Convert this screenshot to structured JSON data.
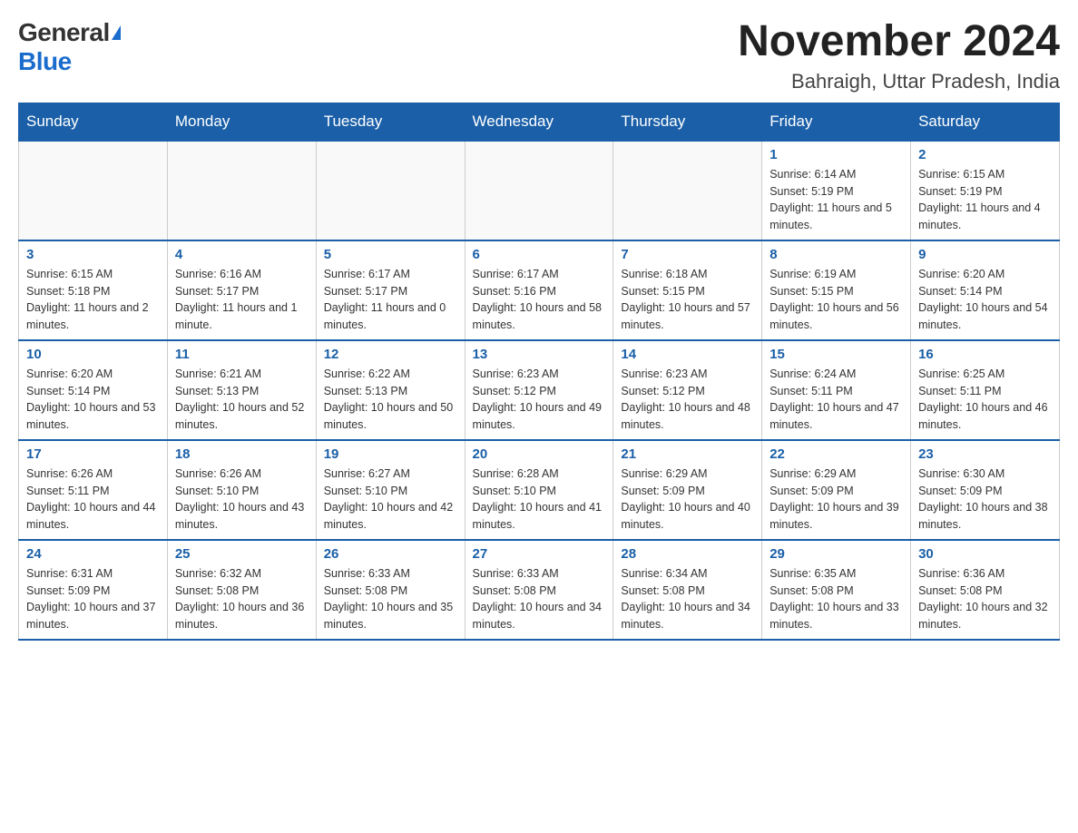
{
  "logo": {
    "general": "General",
    "blue": "Blue"
  },
  "title": {
    "month_year": "November 2024",
    "location": "Bahraigh, Uttar Pradesh, India"
  },
  "days_of_week": [
    "Sunday",
    "Monday",
    "Tuesday",
    "Wednesday",
    "Thursday",
    "Friday",
    "Saturday"
  ],
  "weeks": [
    [
      {
        "day": "",
        "info": ""
      },
      {
        "day": "",
        "info": ""
      },
      {
        "day": "",
        "info": ""
      },
      {
        "day": "",
        "info": ""
      },
      {
        "day": "",
        "info": ""
      },
      {
        "day": "1",
        "info": "Sunrise: 6:14 AM\nSunset: 5:19 PM\nDaylight: 11 hours and 5 minutes."
      },
      {
        "day": "2",
        "info": "Sunrise: 6:15 AM\nSunset: 5:19 PM\nDaylight: 11 hours and 4 minutes."
      }
    ],
    [
      {
        "day": "3",
        "info": "Sunrise: 6:15 AM\nSunset: 5:18 PM\nDaylight: 11 hours and 2 minutes."
      },
      {
        "day": "4",
        "info": "Sunrise: 6:16 AM\nSunset: 5:17 PM\nDaylight: 11 hours and 1 minute."
      },
      {
        "day": "5",
        "info": "Sunrise: 6:17 AM\nSunset: 5:17 PM\nDaylight: 11 hours and 0 minutes."
      },
      {
        "day": "6",
        "info": "Sunrise: 6:17 AM\nSunset: 5:16 PM\nDaylight: 10 hours and 58 minutes."
      },
      {
        "day": "7",
        "info": "Sunrise: 6:18 AM\nSunset: 5:15 PM\nDaylight: 10 hours and 57 minutes."
      },
      {
        "day": "8",
        "info": "Sunrise: 6:19 AM\nSunset: 5:15 PM\nDaylight: 10 hours and 56 minutes."
      },
      {
        "day": "9",
        "info": "Sunrise: 6:20 AM\nSunset: 5:14 PM\nDaylight: 10 hours and 54 minutes."
      }
    ],
    [
      {
        "day": "10",
        "info": "Sunrise: 6:20 AM\nSunset: 5:14 PM\nDaylight: 10 hours and 53 minutes."
      },
      {
        "day": "11",
        "info": "Sunrise: 6:21 AM\nSunset: 5:13 PM\nDaylight: 10 hours and 52 minutes."
      },
      {
        "day": "12",
        "info": "Sunrise: 6:22 AM\nSunset: 5:13 PM\nDaylight: 10 hours and 50 minutes."
      },
      {
        "day": "13",
        "info": "Sunrise: 6:23 AM\nSunset: 5:12 PM\nDaylight: 10 hours and 49 minutes."
      },
      {
        "day": "14",
        "info": "Sunrise: 6:23 AM\nSunset: 5:12 PM\nDaylight: 10 hours and 48 minutes."
      },
      {
        "day": "15",
        "info": "Sunrise: 6:24 AM\nSunset: 5:11 PM\nDaylight: 10 hours and 47 minutes."
      },
      {
        "day": "16",
        "info": "Sunrise: 6:25 AM\nSunset: 5:11 PM\nDaylight: 10 hours and 46 minutes."
      }
    ],
    [
      {
        "day": "17",
        "info": "Sunrise: 6:26 AM\nSunset: 5:11 PM\nDaylight: 10 hours and 44 minutes."
      },
      {
        "day": "18",
        "info": "Sunrise: 6:26 AM\nSunset: 5:10 PM\nDaylight: 10 hours and 43 minutes."
      },
      {
        "day": "19",
        "info": "Sunrise: 6:27 AM\nSunset: 5:10 PM\nDaylight: 10 hours and 42 minutes."
      },
      {
        "day": "20",
        "info": "Sunrise: 6:28 AM\nSunset: 5:10 PM\nDaylight: 10 hours and 41 minutes."
      },
      {
        "day": "21",
        "info": "Sunrise: 6:29 AM\nSunset: 5:09 PM\nDaylight: 10 hours and 40 minutes."
      },
      {
        "day": "22",
        "info": "Sunrise: 6:29 AM\nSunset: 5:09 PM\nDaylight: 10 hours and 39 minutes."
      },
      {
        "day": "23",
        "info": "Sunrise: 6:30 AM\nSunset: 5:09 PM\nDaylight: 10 hours and 38 minutes."
      }
    ],
    [
      {
        "day": "24",
        "info": "Sunrise: 6:31 AM\nSunset: 5:09 PM\nDaylight: 10 hours and 37 minutes."
      },
      {
        "day": "25",
        "info": "Sunrise: 6:32 AM\nSunset: 5:08 PM\nDaylight: 10 hours and 36 minutes."
      },
      {
        "day": "26",
        "info": "Sunrise: 6:33 AM\nSunset: 5:08 PM\nDaylight: 10 hours and 35 minutes."
      },
      {
        "day": "27",
        "info": "Sunrise: 6:33 AM\nSunset: 5:08 PM\nDaylight: 10 hours and 34 minutes."
      },
      {
        "day": "28",
        "info": "Sunrise: 6:34 AM\nSunset: 5:08 PM\nDaylight: 10 hours and 34 minutes."
      },
      {
        "day": "29",
        "info": "Sunrise: 6:35 AM\nSunset: 5:08 PM\nDaylight: 10 hours and 33 minutes."
      },
      {
        "day": "30",
        "info": "Sunrise: 6:36 AM\nSunset: 5:08 PM\nDaylight: 10 hours and 32 minutes."
      }
    ]
  ]
}
